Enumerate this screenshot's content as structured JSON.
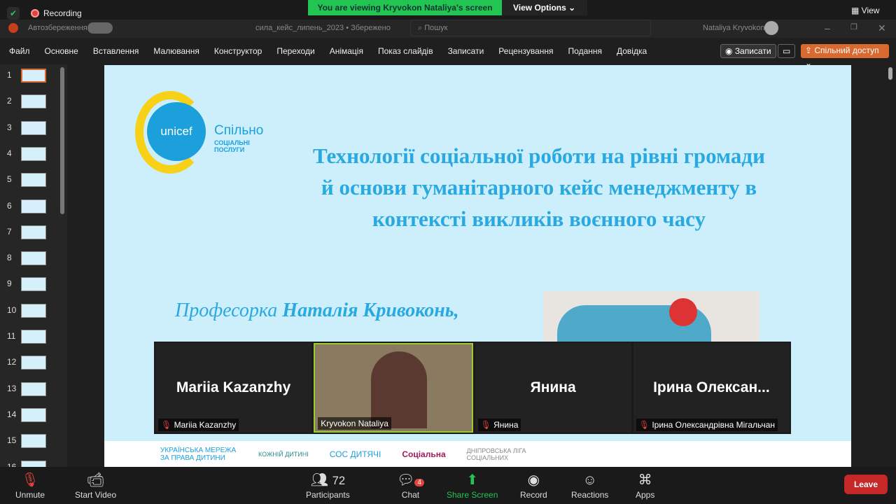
{
  "zoom": {
    "recording": "Recording",
    "banner": "You are viewing Kryvokon Nataliya's screen",
    "view_options": "View Options",
    "view": "View"
  },
  "ppt": {
    "autosave": "Автозбереження",
    "filename": "сила_кейс_липень_2023 • Збережено",
    "search": "Пошук",
    "user": "Nataliya Kryvokon",
    "menu": [
      "Файл",
      "Основне",
      "Вставлення",
      "Малювання",
      "Конструктор",
      "Переходи",
      "Анімація",
      "Показ слайдів",
      "Записати",
      "Рецензування",
      "Подання",
      "Довідка"
    ],
    "record_btn": "Записати",
    "share_btn": "Спільний доступ"
  },
  "thumbs": [
    "1",
    "2",
    "3",
    "4",
    "5",
    "6",
    "7",
    "8",
    "9",
    "10",
    "11",
    "12",
    "13",
    "14",
    "15",
    "16"
  ],
  "slide": {
    "logo": "unicef",
    "logo2": "Спільно",
    "logo3": "СОЦІАЛЬНІ ПОСЛУГИ",
    "title_lines": [
      "Технології соціальної роботи на рівні громади",
      "й основи гуманітарного  кейс менеджменту в",
      "контексті викликів воєнного часу"
    ],
    "prof_prefix": "Професорка ",
    "prof_name": "Наталія Кривоконь,",
    "logos": [
      "УКРАЇНСЬКА МЕРЕЖА ЗА ПРАВА ДИТИНИ",
      "КОЖНІЙ ДИТИНІ",
      "СОС ДИТЯЧІ",
      "Соціальна",
      "ДНІПРОВСЬКА ЛІГА СОЦІАЛЬНИХ"
    ]
  },
  "gallery": [
    {
      "big": "Mariia Kazanzhy",
      "name": "Mariia Kazanzhy"
    },
    {
      "big": "",
      "name": "Kryvokon Nataliya"
    },
    {
      "big": "Янина",
      "name": "Янина"
    },
    {
      "big": "Ірина  Олексан...",
      "name": "Ірина Олександрівна Мігальчан"
    }
  ],
  "toolbar": {
    "unmute": "Unmute",
    "video": "Start Video",
    "participants": "Participants",
    "participants_count": "72",
    "chat": "Chat",
    "chat_badge": "4",
    "share": "Share Screen",
    "record": "Record",
    "reactions": "Reactions",
    "apps": "Apps",
    "leave": "Leave"
  }
}
